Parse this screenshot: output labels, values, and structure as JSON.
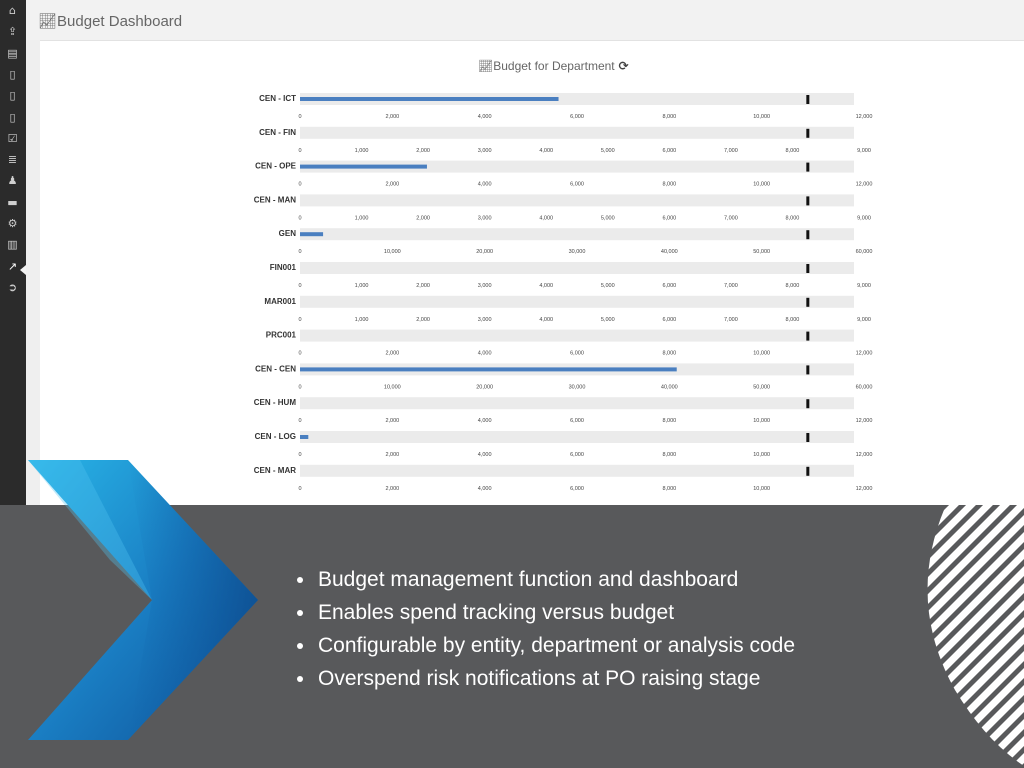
{
  "app": {
    "title": "Budget Dashboard",
    "title_icon": "line-chart-icon"
  },
  "sidebar": {
    "items": [
      {
        "icon": "home-icon",
        "glyph": "⌂"
      },
      {
        "icon": "upload-icon",
        "glyph": "⇪"
      },
      {
        "icon": "document-icon",
        "glyph": "▤"
      },
      {
        "icon": "file-icon",
        "glyph": "▯"
      },
      {
        "icon": "file-chart-icon",
        "glyph": "▯"
      },
      {
        "icon": "file-chart-icon",
        "glyph": "▯"
      },
      {
        "icon": "checkbox-icon",
        "glyph": "☑"
      },
      {
        "icon": "database-icon",
        "glyph": "≣"
      },
      {
        "icon": "users-icon",
        "glyph": "♟"
      },
      {
        "icon": "suitcase-icon",
        "glyph": "▬"
      },
      {
        "icon": "gear-icon",
        "glyph": "⚙"
      },
      {
        "icon": "bar-chart-icon",
        "glyph": "▥"
      },
      {
        "icon": "line-chart-icon",
        "glyph": "↗"
      },
      {
        "icon": "arrow-circle-icon",
        "glyph": "➲"
      }
    ],
    "active_index": 12
  },
  "chart_data": {
    "type": "bar",
    "title": "Budget for Department",
    "title_icon": "line-chart-icon",
    "refresh_icon": "refresh-icon",
    "orientation": "horizontal",
    "layout": "bullet",
    "bar_color": "#4a7fc0",
    "target_color": "#111111",
    "background_color": "#ebebeb",
    "rows": [
      {
        "label": "CEN - ICT",
        "value": 5600,
        "target": 11000,
        "xlim": [
          0,
          12000
        ],
        "ticks": [
          "0",
          "2,000",
          "4,000",
          "6,000",
          "8,000",
          "10,000",
          "12,000"
        ]
      },
      {
        "label": "CEN - FIN",
        "value": 0,
        "target": 8250,
        "xlim": [
          0,
          9000
        ],
        "ticks": [
          "0",
          "1,000",
          "2,000",
          "3,000",
          "4,000",
          "5,000",
          "6,000",
          "7,000",
          "8,000",
          "9,000"
        ]
      },
      {
        "label": "CEN - OPE",
        "value": 2750,
        "target": 11000,
        "xlim": [
          0,
          12000
        ],
        "ticks": [
          "0",
          "2,000",
          "4,000",
          "6,000",
          "8,000",
          "10,000",
          "12,000"
        ]
      },
      {
        "label": "CEN - MAN",
        "value": 0,
        "target": 8250,
        "xlim": [
          0,
          9000
        ],
        "ticks": [
          "0",
          "1,000",
          "2,000",
          "3,000",
          "4,000",
          "5,000",
          "6,000",
          "7,000",
          "8,000",
          "9,000"
        ]
      },
      {
        "label": "GEN",
        "value": 2500,
        "target": 55000,
        "xlim": [
          0,
          60000
        ],
        "ticks": [
          "0",
          "10,000",
          "20,000",
          "30,000",
          "40,000",
          "50,000",
          "60,000"
        ]
      },
      {
        "label": "FIN001",
        "value": 0,
        "target": 8250,
        "xlim": [
          0,
          9000
        ],
        "ticks": [
          "0",
          "1,000",
          "2,000",
          "3,000",
          "4,000",
          "5,000",
          "6,000",
          "7,000",
          "8,000",
          "9,000"
        ]
      },
      {
        "label": "MAR001",
        "value": 0,
        "target": 8250,
        "xlim": [
          0,
          9000
        ],
        "ticks": [
          "0",
          "1,000",
          "2,000",
          "3,000",
          "4,000",
          "5,000",
          "6,000",
          "7,000",
          "8,000",
          "9,000"
        ]
      },
      {
        "label": "PRC001",
        "value": 0,
        "target": 11000,
        "xlim": [
          0,
          12000
        ],
        "ticks": [
          "0",
          "2,000",
          "4,000",
          "6,000",
          "8,000",
          "10,000",
          "12,000"
        ]
      },
      {
        "label": "CEN - CEN",
        "value": 40800,
        "target": 55000,
        "xlim": [
          0,
          60000
        ],
        "ticks": [
          "0",
          "10,000",
          "20,000",
          "30,000",
          "40,000",
          "50,000",
          "60,000"
        ]
      },
      {
        "label": "CEN - HUM",
        "value": 0,
        "target": 11000,
        "xlim": [
          0,
          12000
        ],
        "ticks": [
          "0",
          "2,000",
          "4,000",
          "6,000",
          "8,000",
          "10,000",
          "12,000"
        ]
      },
      {
        "label": "CEN - LOG",
        "value": 180,
        "target": 11000,
        "xlim": [
          0,
          12000
        ],
        "ticks": [
          "0",
          "2,000",
          "4,000",
          "6,000",
          "8,000",
          "10,000",
          "12,000"
        ]
      },
      {
        "label": "CEN - MAR",
        "value": 0,
        "target": 11000,
        "xlim": [
          0,
          12000
        ],
        "ticks": [
          "0",
          "2,000",
          "4,000",
          "6,000",
          "8,000",
          "10,000",
          "12,000"
        ]
      }
    ]
  },
  "features": [
    "Budget management function and dashboard",
    "Enables spend tracking versus budget",
    "Configurable by entity, department or analysis code",
    "Overspend risk notifications at PO raising stage"
  ],
  "colors": {
    "sidebar_bg": "#2b2b2b",
    "topbar_bg": "#f2f2f2",
    "bottom_panel": "#58595b",
    "chevron_blue": "#1a7fc4"
  }
}
